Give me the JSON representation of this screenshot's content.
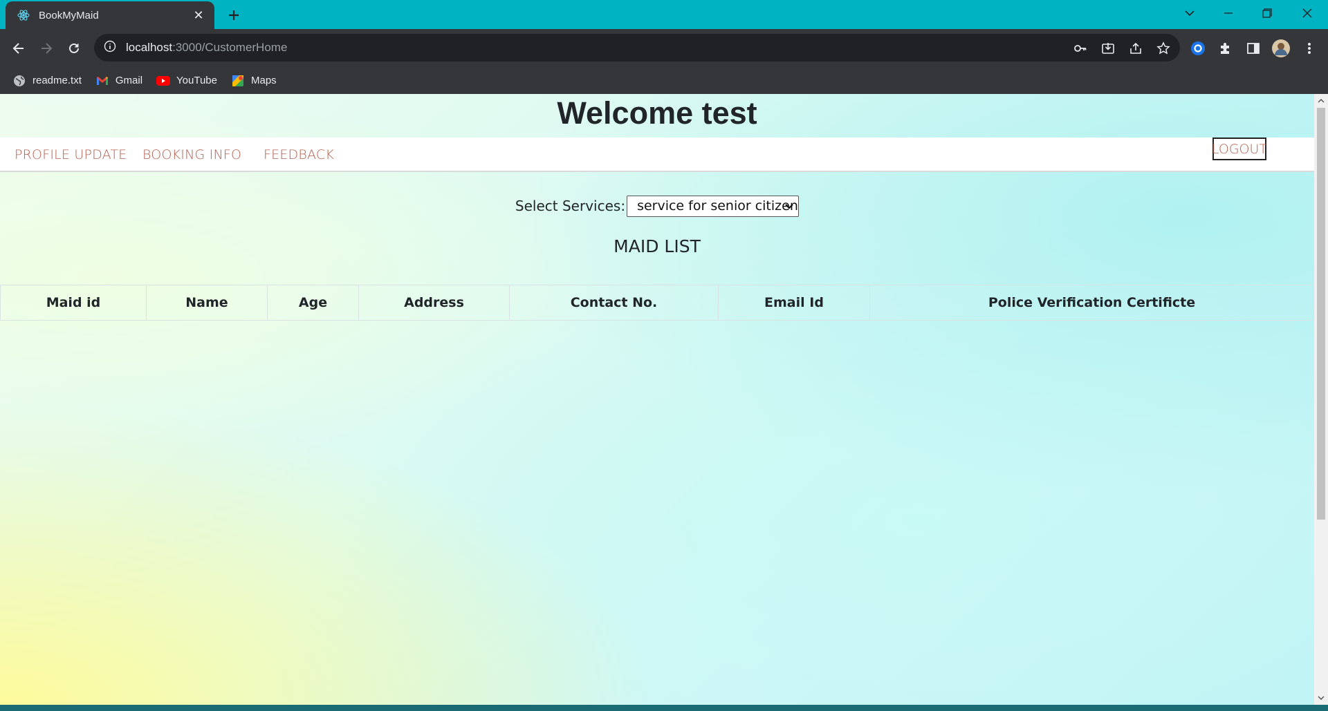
{
  "browser": {
    "tab_title": "BookMyMaid",
    "url_host": "localhost",
    "url_path": ":3000/CustomerHome",
    "bookmarks": [
      {
        "label": "readme.txt",
        "icon": "globe-icon"
      },
      {
        "label": "Gmail",
        "icon": "gmail-icon"
      },
      {
        "label": "YouTube",
        "icon": "youtube-icon"
      },
      {
        "label": "Maps",
        "icon": "maps-icon"
      }
    ]
  },
  "page": {
    "welcome": "Welcome test",
    "nav": {
      "profile_update": "PROFILE UPDATE",
      "booking_info": "BOOKING INFO",
      "feedback": "FEEDBACK",
      "logout": "LOGOUT"
    },
    "services": {
      "label": "Select Services:",
      "selected": "service for senior citizen"
    },
    "list_title": "MAID LIST",
    "table": {
      "headers": [
        "Maid id",
        "Name",
        "Age",
        "Address",
        "Contact No.",
        "Email Id",
        "Police Verification Certificte"
      ],
      "rows": []
    }
  },
  "colors": {
    "chrome_accent": "#00b3c3",
    "chrome_dark": "#35363a",
    "nav_link": "#b35c4c"
  }
}
